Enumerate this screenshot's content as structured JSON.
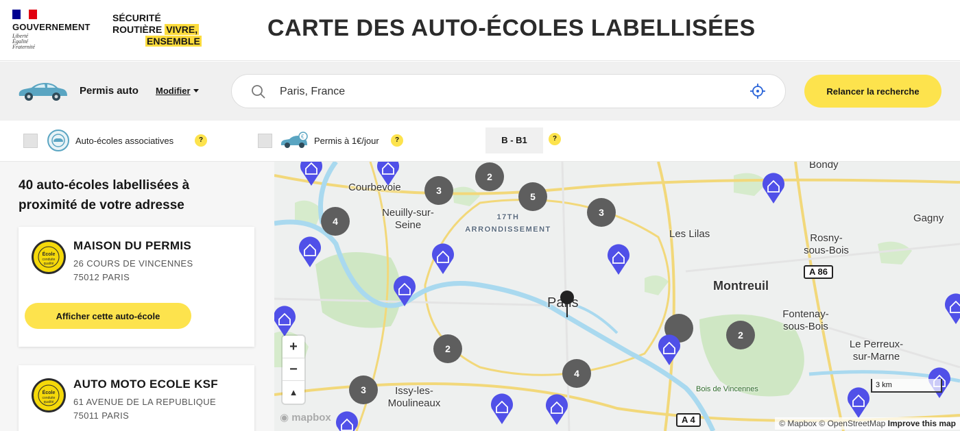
{
  "header": {
    "gov_name": "GOUVERNEMENT",
    "gov_motto": [
      "Liberté",
      "Égalité",
      "Fraternité"
    ],
    "sr_line1": "SÉCURITÉ",
    "sr_line2a": "ROUTIÈRE",
    "sr_line2b": "VIVRE,",
    "sr_line3": "ENSEMBLE",
    "title": "CARTE DES AUTO-ÉCOLES LABELLISÉES"
  },
  "search": {
    "permit": "Permis auto",
    "modify": "Modifier",
    "value": "Paris, France",
    "relaunch": "Relancer la recherche"
  },
  "filters": {
    "associative": "Auto-écoles associatives",
    "one_euro": "Permis à 1€/jour",
    "permit_type": "B - B1",
    "help": "?"
  },
  "list": {
    "title": "40 auto-écoles labellisées à proximité de votre adresse",
    "cards": [
      {
        "name": "MAISON DU PERMIS",
        "street": "26 COURS DE VINCENNES",
        "city": "75012 PARIS",
        "button": "Afficher cette auto-école"
      },
      {
        "name": "AUTO MOTO ECOLE KSF",
        "street": "61 AVENUE DE LA REPUBLIQUE",
        "city": "75011 PARIS"
      }
    ]
  },
  "map": {
    "places": [
      "Courbevoie",
      "Neuilly-sur-Seine",
      "17TH ARRONDISSEMENT",
      "Bondy",
      "Gagny",
      "Les Lilas",
      "Rosny-sous-Bois",
      "Montreuil",
      "Paris",
      "Fontenay-sous-Bois",
      "Le Perreux-sur-Marne",
      "Bois de Vincennes",
      "Issy-les-Moulineaux"
    ],
    "roads": [
      "A 86",
      "A 4"
    ],
    "clusters": [
      "2",
      "3",
      "5",
      "3",
      "4",
      "2",
      "2",
      "4",
      "3"
    ],
    "zoom_in": "+",
    "zoom_out": "−",
    "compass": "▲",
    "mapbox": "mapbox",
    "scale": "3 km",
    "attribution_a": "© Mapbox",
    "attribution_b": "© OpenStreetMap",
    "attribution_c": "Improve this map"
  },
  "colors": {
    "accent": "#fde34d",
    "pin": "#5050e8",
    "cluster": "#5e5e5e"
  }
}
